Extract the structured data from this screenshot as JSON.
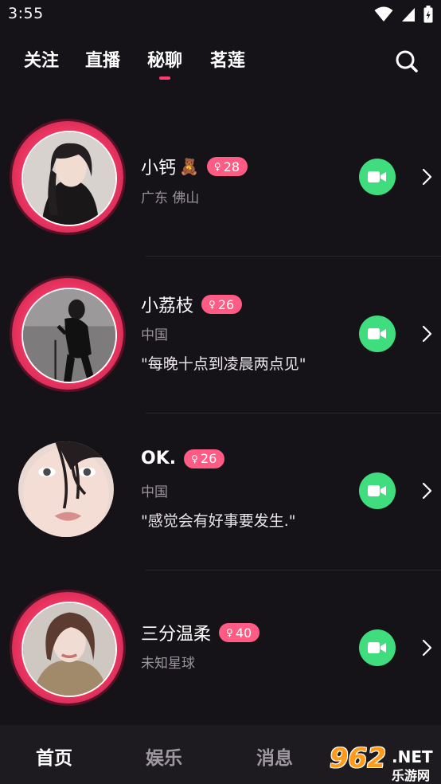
{
  "status_bar": {
    "time": "3:55",
    "icons": [
      "wifi-icon",
      "signal-icon",
      "battery-icon"
    ]
  },
  "top_nav": {
    "tabs": [
      {
        "label": "关注",
        "active": false
      },
      {
        "label": "直播",
        "active": false
      },
      {
        "label": "秘聊",
        "active": true
      },
      {
        "label": "茗莲",
        "active": false
      }
    ],
    "search_icon": "search-icon",
    "accent_color": "#ff3d6e"
  },
  "users": [
    {
      "name": "小钙",
      "emoji": "🧸",
      "gender_symbol": "♀",
      "age": "28",
      "location": "广东 佛山",
      "signature": "",
      "ring": true
    },
    {
      "name": "小荔枝",
      "emoji": "",
      "gender_symbol": "♀",
      "age": "26",
      "location": "中国",
      "signature": "\"每晚十点到凌晨两点见\"",
      "ring": true
    },
    {
      "name": "OK.",
      "emoji": "",
      "gender_symbol": "♀",
      "age": "26",
      "location": "中国",
      "signature": "\"感觉会有好事要发生.\"",
      "ring": false
    },
    {
      "name": "三分温柔",
      "emoji": "",
      "gender_symbol": "♀",
      "age": "40",
      "location": "未知星球",
      "signature": "",
      "ring": true
    }
  ],
  "colors": {
    "video_button": "#3fdd7e",
    "age_badge": "#ff5b84",
    "live_ring": "#ee3561"
  },
  "bottom_nav": {
    "tabs": [
      {
        "label": "首页",
        "active": true
      },
      {
        "label": "娱乐",
        "active": false
      },
      {
        "label": "消息",
        "active": false
      }
    ]
  },
  "watermark": {
    "big": "962",
    "net": ".NET",
    "sub": "乐游网"
  }
}
